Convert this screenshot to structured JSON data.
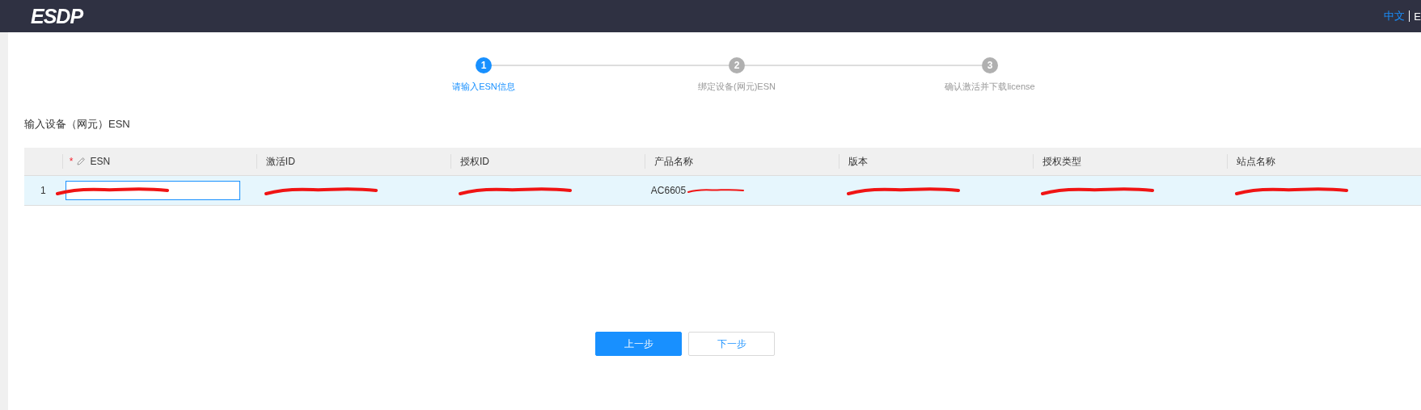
{
  "header": {
    "logo": "ESDP",
    "languages": [
      {
        "label": "中文",
        "selected": true
      },
      {
        "label": "E",
        "selected": false
      }
    ]
  },
  "steps": [
    {
      "number": "1",
      "label": "请输入ESN信息",
      "active": true
    },
    {
      "number": "2",
      "label": "绑定设备(网元)ESN",
      "active": false
    },
    {
      "number": "3",
      "label": "确认激活并下载license",
      "active": false
    }
  ],
  "section_title": "输入设备（网元）ESN",
  "table": {
    "columns": [
      {
        "label": "ESN",
        "required_mark": "*",
        "editable": true
      },
      {
        "label": "激活ID",
        "editable": false
      },
      {
        "label": "授权ID",
        "editable": false
      },
      {
        "label": "产品名称",
        "editable": false
      },
      {
        "label": "版本",
        "editable": false
      },
      {
        "label": "授权类型",
        "editable": false
      },
      {
        "label": "站点名称",
        "editable": false
      }
    ],
    "rows": [
      {
        "index": "1",
        "selected": true,
        "cells": [
          {
            "kind": "input",
            "redacted": true
          },
          {
            "kind": "text",
            "redacted": true
          },
          {
            "kind": "text",
            "redacted": true
          },
          {
            "kind": "text",
            "text": "AC6605",
            "redacted": true
          },
          {
            "kind": "text",
            "redacted": true
          },
          {
            "kind": "text",
            "redacted": true
          },
          {
            "kind": "text",
            "redacted": true
          }
        ]
      }
    ]
  },
  "buttons": [
    {
      "label": "上一步",
      "primary": true
    },
    {
      "label": "下一步",
      "primary": false
    }
  ]
}
